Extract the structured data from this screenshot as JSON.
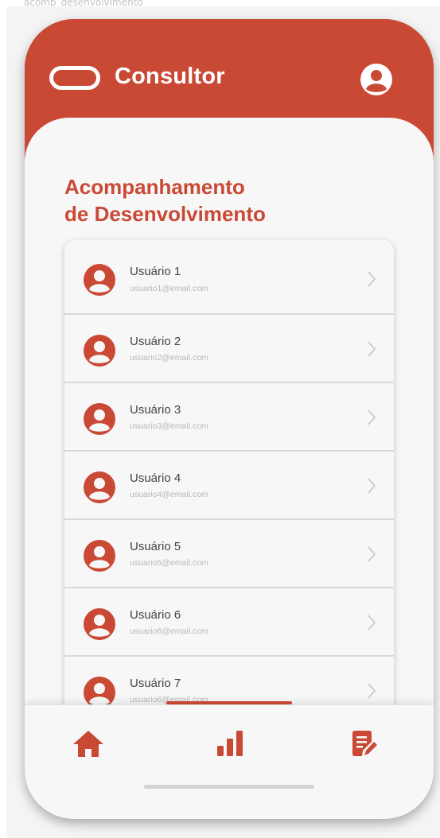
{
  "frame_caption": "acomp_desenvolvimento",
  "header": {
    "brand": "Consultor"
  },
  "page": {
    "title_line1": "Acompanhamento",
    "title_line2": "de Desenvolvimento"
  },
  "users": [
    {
      "name": "Usuário 1",
      "email": "usuario1@email.com"
    },
    {
      "name": "Usuário 2",
      "email": "usuario2@email.com"
    },
    {
      "name": "Usuário 3",
      "email": "usuario3@email.com"
    },
    {
      "name": "Usuário 4",
      "email": "usuario4@email.com"
    },
    {
      "name": "Usuário 5",
      "email": "usuario5@email.com"
    },
    {
      "name": "Usuário 6",
      "email": "usuario6@email.com"
    },
    {
      "name": "Usuário 7",
      "email": "usuario6@email.com"
    }
  ],
  "colors": {
    "primary": "#c94935",
    "background": "#f7f7f7",
    "text": "#444444",
    "muted": "#b8b8b8"
  },
  "icons": {
    "logo": "pill-outline-logo-icon",
    "profile": "user-circle-icon",
    "row_avatar": "user-circle-icon",
    "row_chevron": "chevron-right-icon",
    "nav_home": "home-icon",
    "nav_chart": "bar-chart-icon",
    "nav_notes": "edit-note-icon"
  }
}
